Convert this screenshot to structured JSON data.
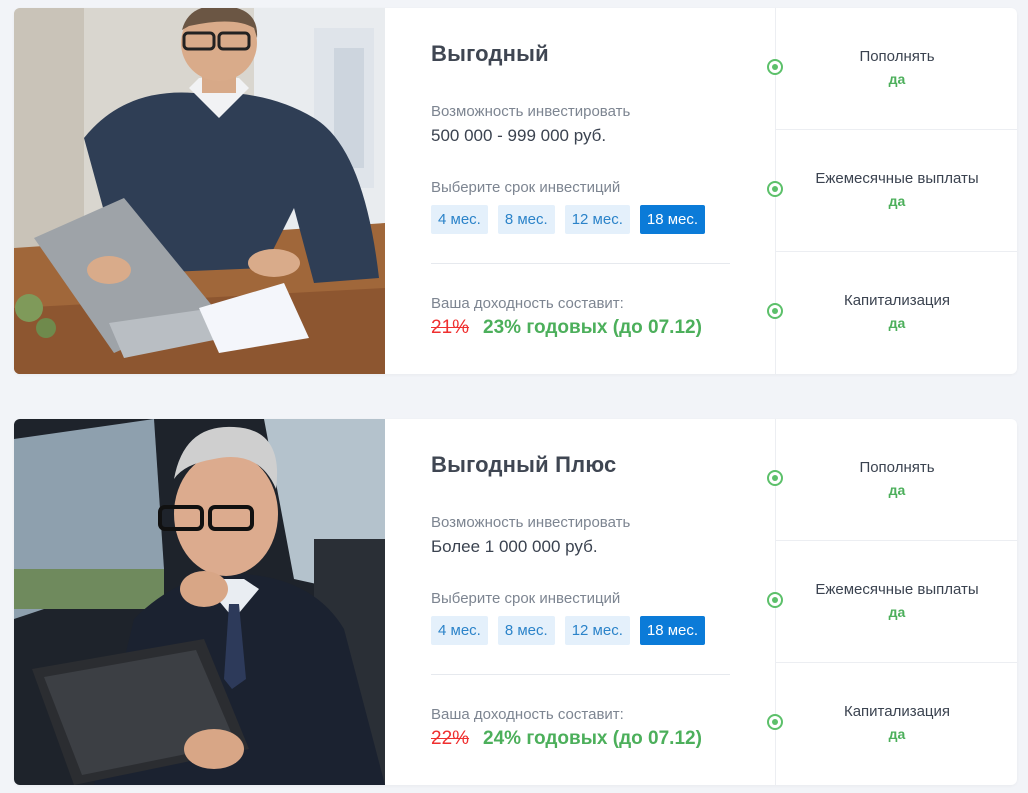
{
  "plans": [
    {
      "title": "Выгодный",
      "photo_icon": "businessman-laptop-photo",
      "invest_label": "Возможность инвестировать",
      "invest_amount": "500 000 - 999 000 руб.",
      "term_label": "Выберите срок инвестиций",
      "terms": [
        "4 мес.",
        "8 мес.",
        "12 мес.",
        "18 мес."
      ],
      "active_term": "18 мес.",
      "yield_label": "Ваша доходность составит:",
      "old_rate": "21%",
      "new_rate": "23% годовых (до 07.12)",
      "features": [
        {
          "label": "Пополнять",
          "value": "да"
        },
        {
          "label": "Ежемесячные выплаты",
          "value": "да"
        },
        {
          "label": "Капитализация",
          "value": "да"
        }
      ]
    },
    {
      "title": "Выгодный Плюс",
      "photo_icon": "businessman-tablet-car-photo",
      "invest_label": "Возможность инвестировать",
      "invest_amount": "Более 1 000 000 руб.",
      "term_label": "Выберите срок инвестиций",
      "terms": [
        "4 мес.",
        "8 мес.",
        "12 мес.",
        "18 мес."
      ],
      "active_term": "18 мес.",
      "yield_label": "Ваша доходность составит:",
      "old_rate": "22%",
      "new_rate": "24% годовых (до 07.12)",
      "features": [
        {
          "label": "Пополнять",
          "value": "да"
        },
        {
          "label": "Ежемесячные выплаты",
          "value": "да"
        },
        {
          "label": "Капитализация",
          "value": "да"
        }
      ]
    }
  ],
  "colors": {
    "accent": "#0b7bd8",
    "term_bg": "#e4f0fb",
    "green": "#4caf5b",
    "red": "#ef2f2f"
  }
}
